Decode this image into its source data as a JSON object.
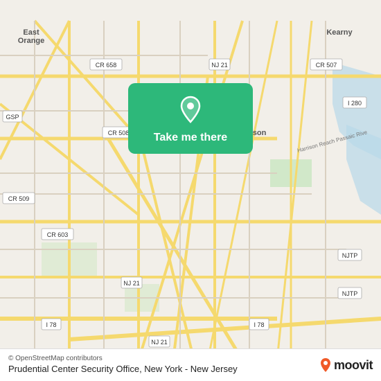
{
  "map": {
    "attribution": "© OpenStreetMap contributors",
    "location_label": "Prudential Center Security Office, New York - New Jersey",
    "bg_color": "#f2efe9"
  },
  "action_card": {
    "button_label": "Take me there"
  },
  "moovit": {
    "logo_text": "moovit"
  }
}
